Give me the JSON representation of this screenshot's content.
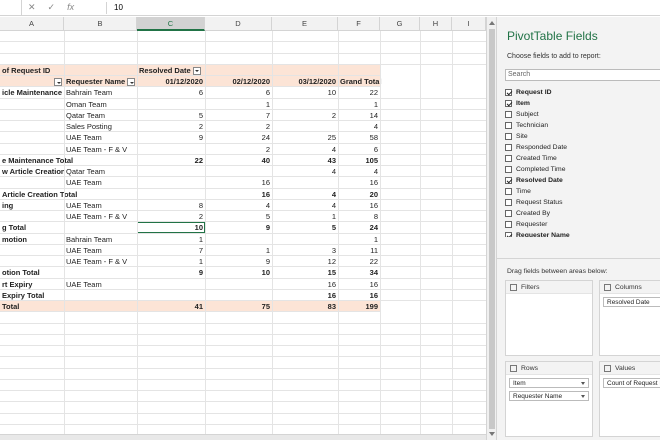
{
  "formula_bar": {
    "value": "10",
    "cancel": "✕",
    "enter": "✓",
    "fx": "fx"
  },
  "columns": [
    "A",
    "B",
    "C",
    "D",
    "E",
    "F",
    "G",
    "H",
    "I"
  ],
  "pivot": {
    "r1_a": "of Request ID",
    "r1_c": "Resolved Date",
    "r2_a": "",
    "r2_b": "Requester Name",
    "dates": [
      "01/12/2020",
      "02/12/2020",
      "03/12/2020"
    ],
    "grand_total_label": "Grand Total",
    "rows": [
      {
        "a": "icle Maintenance",
        "b": "Bahrain Team",
        "c": "6",
        "d": "6",
        "e": "10",
        "f": "22",
        "bold": false
      },
      {
        "a": "",
        "b": "Oman Team",
        "c": "",
        "d": "1",
        "e": "",
        "f": "1",
        "bold": false
      },
      {
        "a": "",
        "b": "Qatar Team",
        "c": "5",
        "d": "7",
        "e": "2",
        "f": "14",
        "bold": false
      },
      {
        "a": "",
        "b": "Sales Posting",
        "c": "2",
        "d": "2",
        "e": "",
        "f": "4",
        "bold": false
      },
      {
        "a": "",
        "b": "UAE Team",
        "c": "9",
        "d": "24",
        "e": "25",
        "f": "58",
        "bold": false
      },
      {
        "a": "",
        "b": "UAE Team - F & V",
        "c": "",
        "d": "2",
        "e": "4",
        "f": "6",
        "bold": false
      },
      {
        "a": "e Maintenance Total",
        "b": "",
        "c": "22",
        "d": "40",
        "e": "43",
        "f": "105",
        "bold": true
      },
      {
        "a": "w Article Creation",
        "b": "Qatar Team",
        "c": "",
        "d": "",
        "e": "4",
        "f": "4",
        "bold": false
      },
      {
        "a": "",
        "b": "UAE Team",
        "c": "",
        "d": "16",
        "e": "",
        "f": "16",
        "bold": false
      },
      {
        "a": "Article Creation Total",
        "b": "",
        "c": "",
        "d": "16",
        "e": "4",
        "f": "20",
        "bold": true
      },
      {
        "a": "ing",
        "b": "UAE Team",
        "c": "8",
        "d": "4",
        "e": "4",
        "f": "16",
        "bold": false
      },
      {
        "a": "",
        "b": "UAE Team - F & V",
        "c": "2",
        "d": "5",
        "e": "1",
        "f": "8",
        "bold": false
      },
      {
        "a": "g Total",
        "b": "",
        "c": "10",
        "d": "9",
        "e": "5",
        "f": "24",
        "bold": true,
        "selected": true
      },
      {
        "a": "motion",
        "b": "Bahrain Team",
        "c": "1",
        "d": "",
        "e": "",
        "f": "1",
        "bold": false
      },
      {
        "a": "",
        "b": "UAE Team",
        "c": "7",
        "d": "1",
        "e": "3",
        "f": "11",
        "bold": false
      },
      {
        "a": "",
        "b": "UAE Team - F & V",
        "c": "1",
        "d": "9",
        "e": "12",
        "f": "22",
        "bold": false
      },
      {
        "a": "otion Total",
        "b": "",
        "c": "9",
        "d": "10",
        "e": "15",
        "f": "34",
        "bold": true
      },
      {
        "a": "rt Expiry",
        "b": "UAE Team",
        "c": "",
        "d": "",
        "e": "16",
        "f": "16",
        "bold": false
      },
      {
        "a": "Expiry Total",
        "b": "",
        "c": "",
        "d": "",
        "e": "16",
        "f": "16",
        "bold": true
      },
      {
        "a": "Total",
        "b": "",
        "c": "41",
        "d": "75",
        "e": "83",
        "f": "199",
        "bold": true,
        "grand": true
      }
    ]
  },
  "pane": {
    "title": "PivotTable Fields",
    "subtitle": "Choose fields to add to report:",
    "search_placeholder": "Search",
    "fields": [
      {
        "label": "Request ID",
        "checked": true
      },
      {
        "label": "Item",
        "checked": true
      },
      {
        "label": "Subject",
        "checked": false
      },
      {
        "label": "Technician",
        "checked": false
      },
      {
        "label": "Site",
        "checked": false
      },
      {
        "label": "Responded Date",
        "checked": false
      },
      {
        "label": "Created Time",
        "checked": false
      },
      {
        "label": "Completed Time",
        "checked": false
      },
      {
        "label": "Resolved Date",
        "checked": true
      },
      {
        "label": "Time",
        "checked": false
      },
      {
        "label": "Request Status",
        "checked": false
      },
      {
        "label": "Created By",
        "checked": false
      },
      {
        "label": "Requester",
        "checked": false
      },
      {
        "label": "Requester Name",
        "checked": true
      }
    ],
    "drag_label": "Drag fields between areas below:",
    "filters_label": "Filters",
    "columns_label": "Columns",
    "rows_label": "Rows",
    "values_label": "Values",
    "columns_chips": [
      "Resolved Date"
    ],
    "rows_chips": [
      "Item",
      "Requester Name"
    ],
    "values_chips": [
      "Count of Request I"
    ]
  }
}
